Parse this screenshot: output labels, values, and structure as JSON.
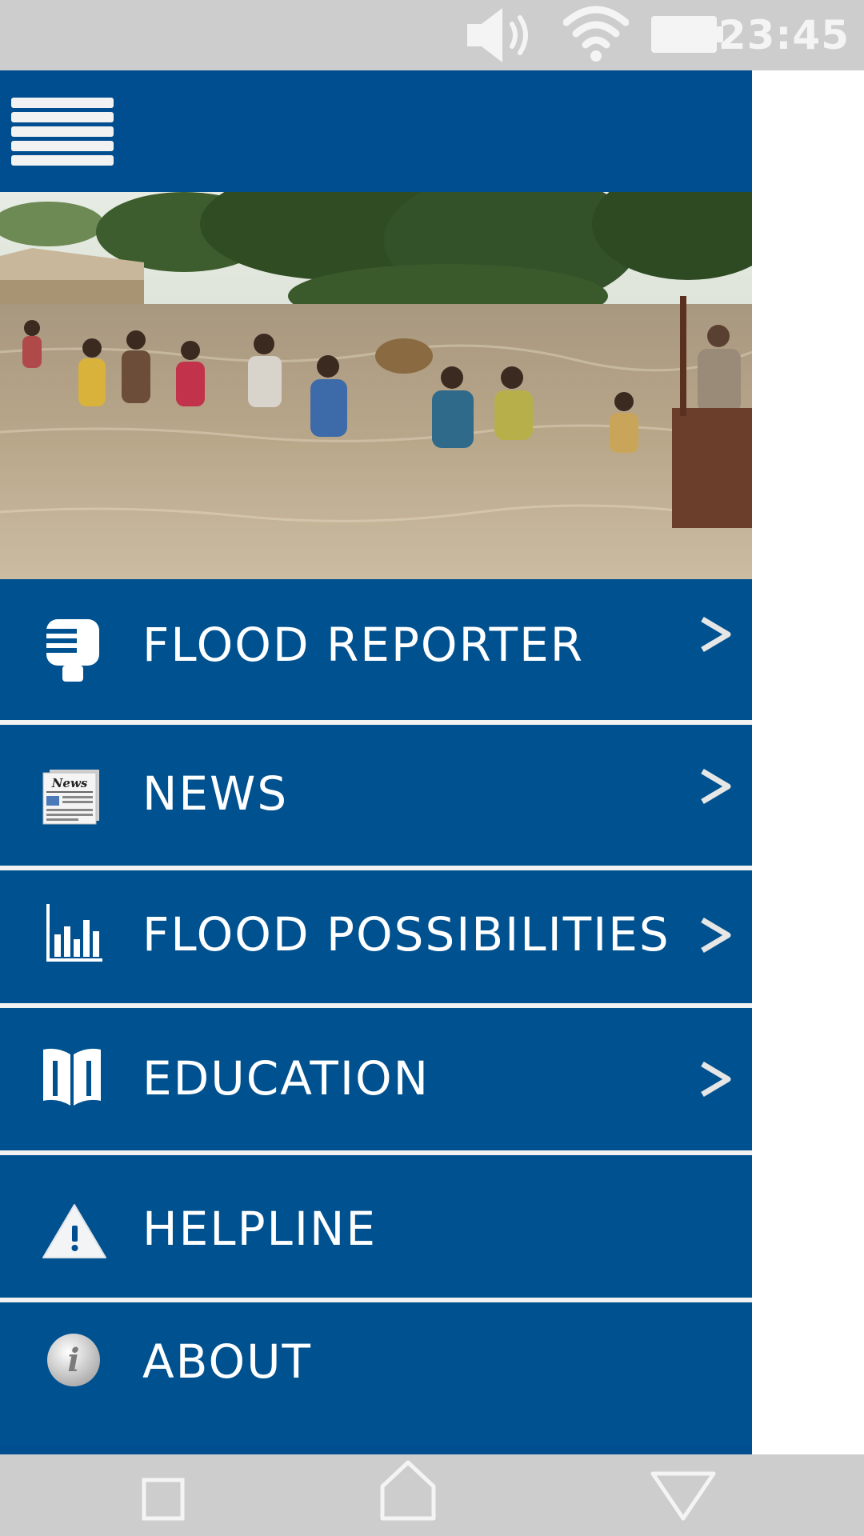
{
  "status_bar": {
    "time": "23:45",
    "icons": [
      "volume-icon",
      "wifi-icon",
      "battery-icon"
    ]
  },
  "header": {
    "menu_icon": "hamburger-menu-icon"
  },
  "hero": {
    "image_subject": "people wading through flood water"
  },
  "menu": {
    "items": [
      {
        "label": "FLOOD REPORTER",
        "icon": "microphone-icon",
        "has_chevron": true
      },
      {
        "label": "NEWS",
        "icon": "newspaper-icon",
        "has_chevron": true,
        "icon_text": "News"
      },
      {
        "label": "FLOOD POSSIBILITIES",
        "icon": "bar-chart-icon",
        "has_chevron": true
      },
      {
        "label": "EDUCATION",
        "icon": "book-icon",
        "has_chevron": true
      },
      {
        "label": "HELPLINE",
        "icon": "warning-icon",
        "has_chevron": false
      },
      {
        "label": "ABOUT",
        "icon": "info-icon",
        "has_chevron": false
      }
    ]
  },
  "nav_bar": {
    "buttons": [
      "recent-apps-icon",
      "home-icon",
      "back-icon"
    ]
  },
  "colors": {
    "primary": "#004d90",
    "status_bar": "#cdcdcd",
    "text": "#ffffff"
  }
}
